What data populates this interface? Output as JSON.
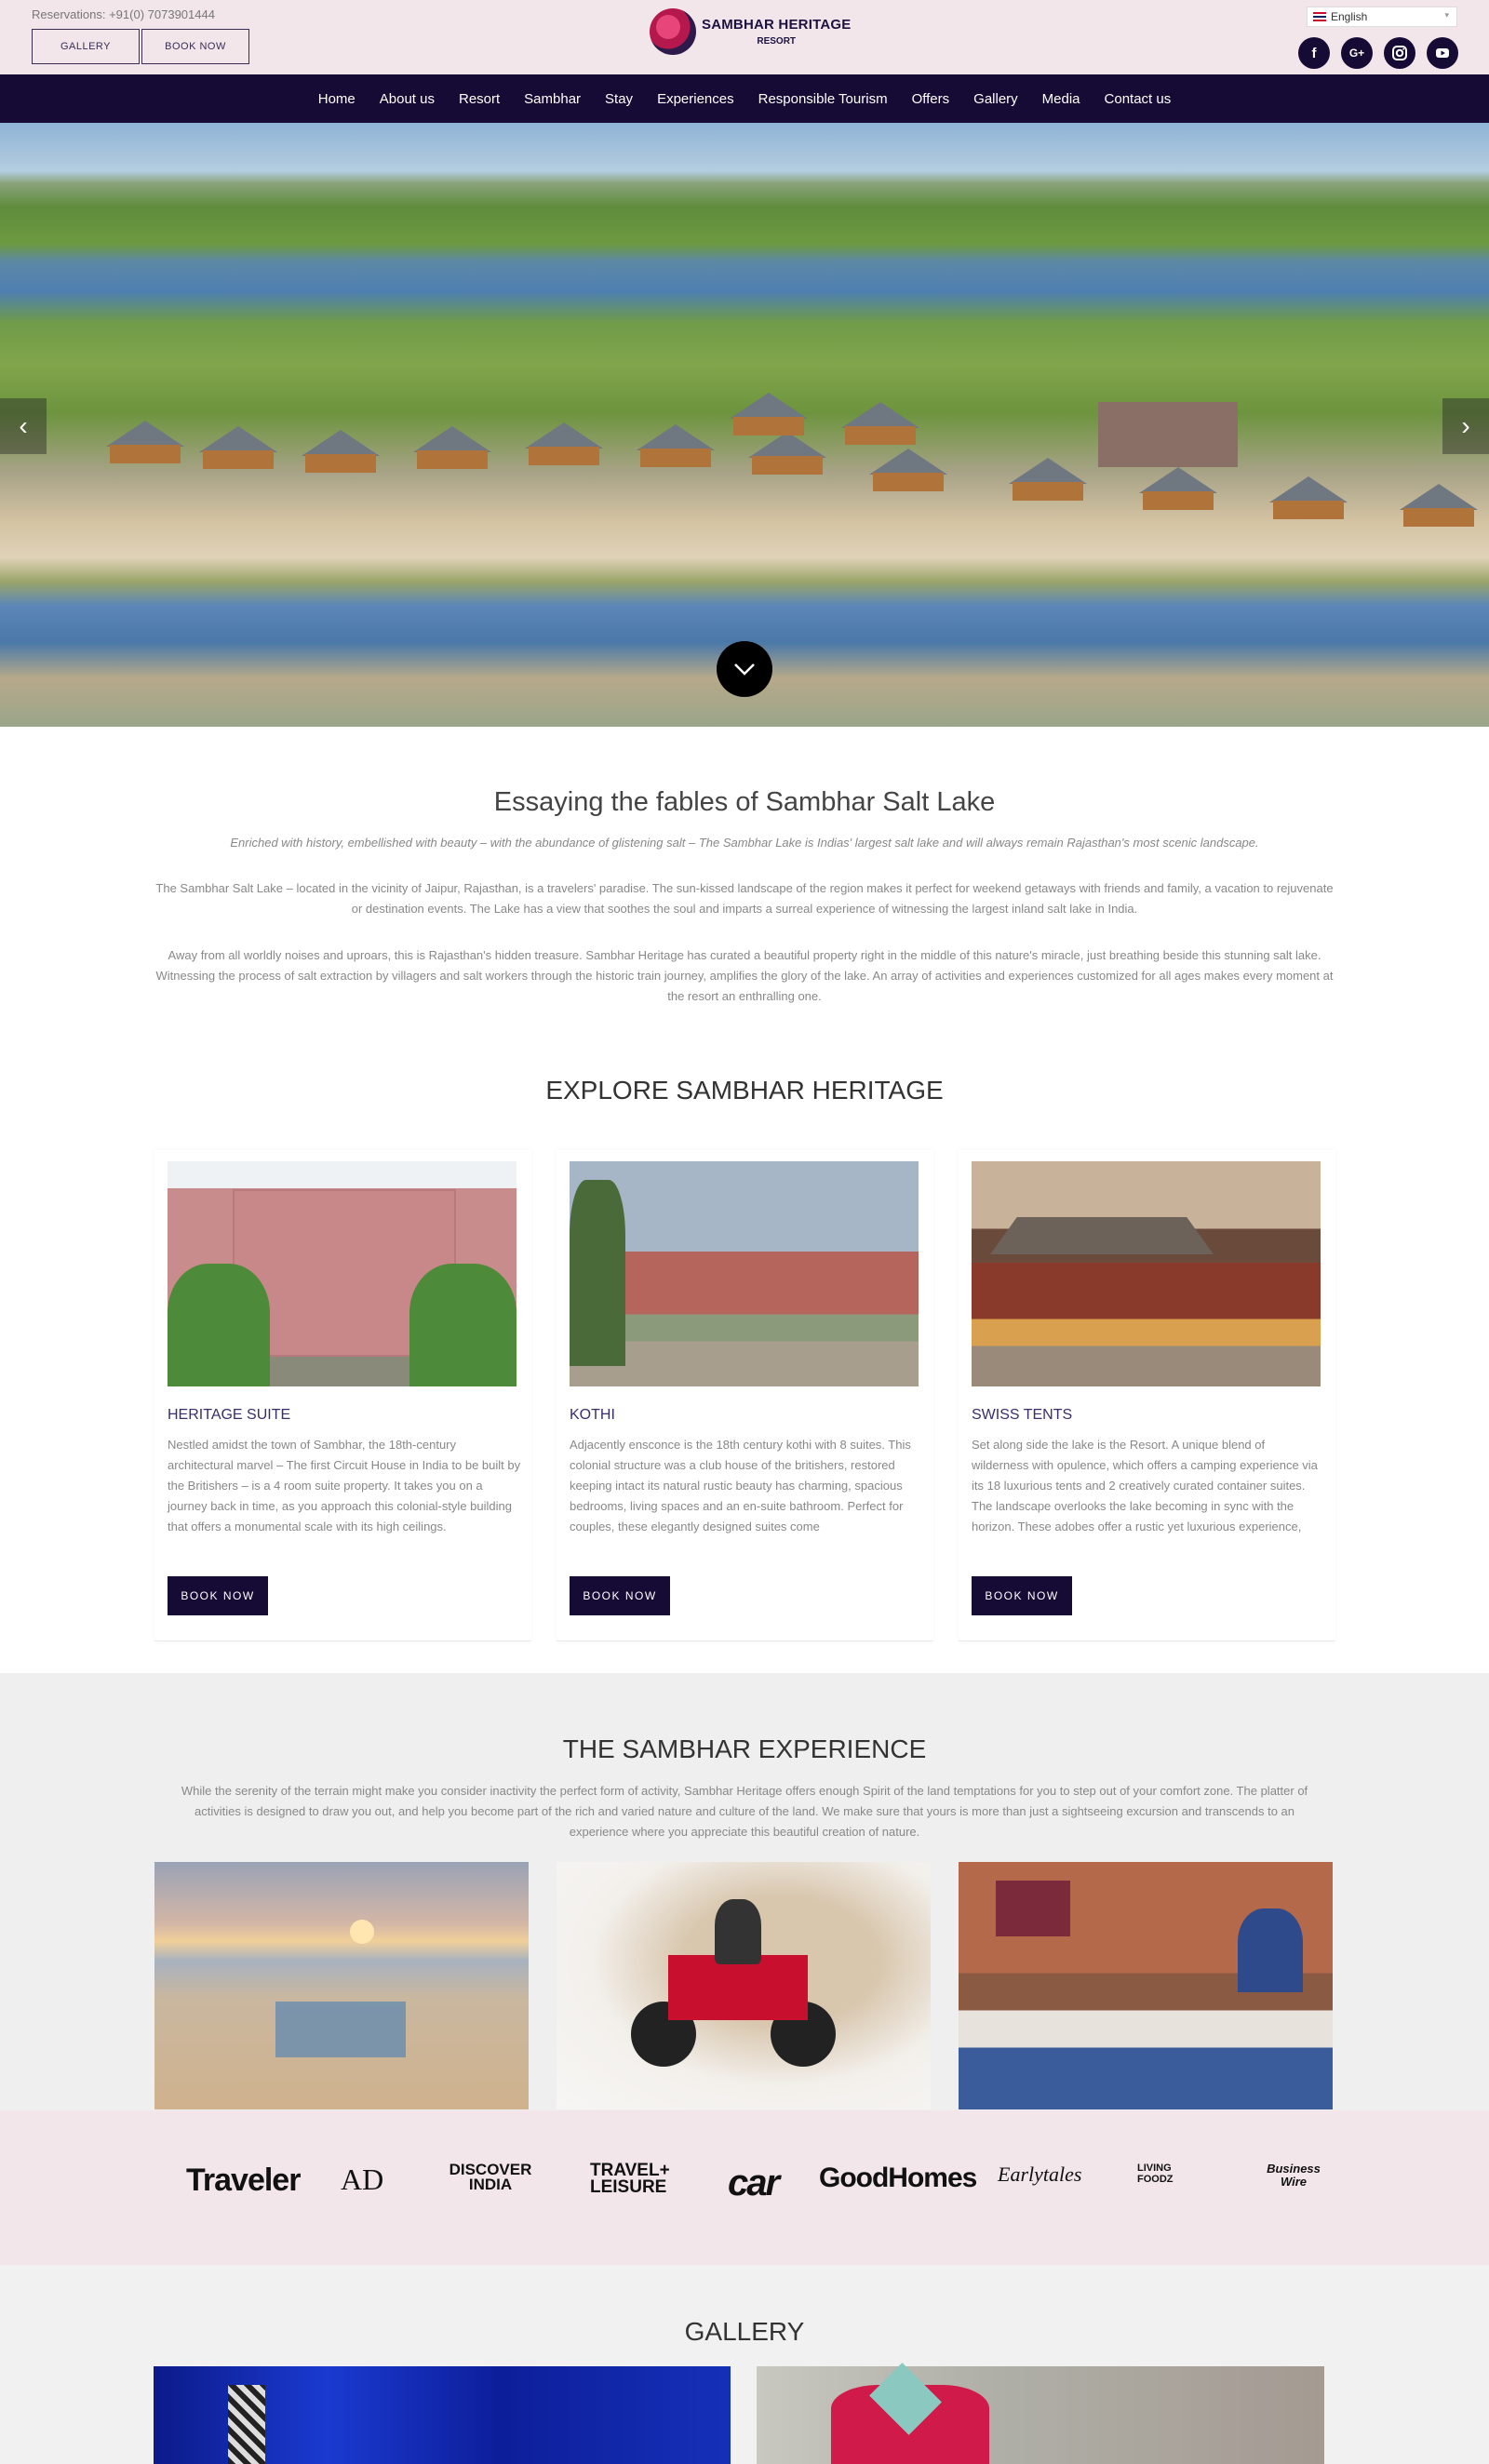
{
  "topbar": {
    "reservation": "Reservations: +91(0) 7073901444",
    "gallery_btn": "GALLERY",
    "book_btn": "BOOK NOW",
    "language": "English",
    "logo_line1": "SAMBHAR HERITAGE",
    "logo_line2": "RESORT",
    "social": [
      "facebook-icon",
      "google-plus-icon",
      "instagram-icon",
      "youtube-icon"
    ]
  },
  "nav": [
    "Home",
    "About us",
    "Resort",
    "Sambhar",
    "Stay",
    "Experiences",
    "Responsible Tourism",
    "Offers",
    "Gallery",
    "Media",
    "Contact us"
  ],
  "intro": {
    "title": "Essaying the fables of Sambhar Salt Lake",
    "tagline": "Enriched with history, embellished with beauty – with the abundance of glistening salt – The Sambhar Lake is Indias' largest salt lake and will always remain Rajasthan's most scenic landscape.",
    "para1": "The Sambhar Salt Lake – located in the vicinity of Jaipur, Rajasthan, is a travelers' paradise. The sun-kissed landscape of the region makes it perfect for weekend getaways with friends and family, a vacation to rejuvenate or destination events. The Lake has a view that soothes the soul and imparts a surreal experience of witnessing the largest inland salt lake in India.",
    "para2": "Away from all worldly noises and uproars, this is Rajasthan's hidden treasure. Sambhar Heritage has curated a beautiful property right in the middle of this nature's miracle, just breathing beside this stunning salt lake. Witnessing the process of salt extraction by villagers and salt workers through the historic train journey, amplifies the glory of the lake. An array of activities and experiences customized for all ages makes every moment at the resort an enthralling one."
  },
  "explore": {
    "title": "EXPLORE SAMBHAR HERITAGE",
    "cards": [
      {
        "title": "HERITAGE SUITE",
        "desc": "Nestled amidst the town of Sambhar, the 18th-century architectural marvel – The first Circuit House in India to be built by the Britishers – is a 4 room suite property. It takes you on a journey back in time, as you approach this colonial-style building that offers a monumental scale with its high ceilings.",
        "button": "BOOK NOW"
      },
      {
        "title": "KOTHI",
        "desc": "Adjacently ensconce is the 18th century kothi with 8 suites. This colonial structure was a club house of the britishers, restored keeping intact its natural rustic beauty has charming, spacious bedrooms, living spaces and an en-suite bathroom. Perfect for couples, these elegantly designed suites come",
        "button": "BOOK NOW"
      },
      {
        "title": "SWISS TENTS",
        "desc": "Set along side the lake is the Resort. A unique blend of wilderness with opulence, which offers a camping experience via its 18 luxurious tents and 2 creatively curated container suites. The landscape overlooks the lake becoming in sync with the horizon. These adobes offer a rustic yet luxurious experience,",
        "button": "BOOK NOW"
      }
    ]
  },
  "experience": {
    "title": "THE SAMBHAR EXPERIENCE",
    "text": "While the serenity of the terrain might make you consider inactivity the perfect form of activity, Sambhar Heritage offers enough Spirit of the land temptations for you to step out of your comfort zone. The platter of activities is designed to draw you out, and help you become part of the rich and varied nature and culture of the land. We make sure that yours is more than just a sightseeing excursion and transcends to an experience where you appreciate this beautiful creation of nature."
  },
  "press": [
    "Traveler",
    "AD",
    "DISCOVER INDIA",
    "TRAVEL+ LEISURE",
    "car",
    "GoodHomes",
    "Earlytales",
    "LIVING FOODZ",
    "Business Wire"
  ],
  "gallery": {
    "title": "GALLERY"
  },
  "colors": {
    "navy": "#150b35",
    "pink_bg": "#f2e6ea"
  }
}
